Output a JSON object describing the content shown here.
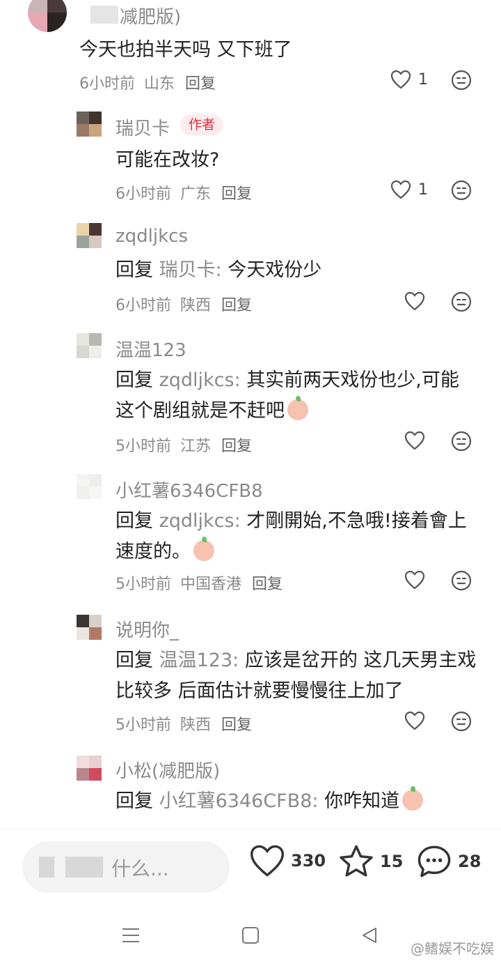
{
  "comments": [
    {
      "name": "减肥版)",
      "author_badge": "",
      "content": "今天也拍半天吗 又下班了",
      "time": "6小时前",
      "location": "山东",
      "reply_label": "回复",
      "likes": "1"
    },
    {
      "name": "瑞贝卡",
      "author_badge": "作者",
      "content": "可能在改妆?",
      "time": "6小时前",
      "location": "广东",
      "reply_label": "回复",
      "likes": "1"
    },
    {
      "name": "zqdljkcs",
      "reply_prefix": "回复",
      "reply_target": "瑞贝卡:",
      "content": "今天戏份少",
      "time": "6小时前",
      "location": "陕西",
      "reply_label": "回复",
      "likes": ""
    },
    {
      "name": "温温123",
      "reply_prefix": "回复",
      "reply_target": "zqdljkcs:",
      "content": "其实前两天戏份也少,可能这个剧组就是不赶吧",
      "time": "5小时前",
      "location": "江苏",
      "reply_label": "回复",
      "likes": ""
    },
    {
      "name": "小红薯6346CFB8",
      "reply_prefix": "回复",
      "reply_target": "zqdljkcs:",
      "content": "才剛開始,不急哦!接着會上速度的。",
      "time": "5小时前",
      "location": "中国香港",
      "reply_label": "回复",
      "likes": ""
    },
    {
      "name": "说明你_",
      "reply_prefix": "回复",
      "reply_target": "温温123:",
      "content": "应该是岔开的 这几天男主戏比较多 后面估计就要慢慢往上加了",
      "time": "5小时前",
      "location": "陕西",
      "reply_label": "回复",
      "likes": ""
    },
    {
      "name": "小松(减肥版)",
      "reply_prefix": "回复",
      "reply_target": "小红薯6346CFB8:",
      "content": "你咋知道",
      "time": "",
      "location": "",
      "reply_label": "",
      "likes": ""
    }
  ],
  "bottom_bar": {
    "input_placeholder": "什么...",
    "like_count": "330",
    "star_count": "15",
    "comment_count": "28"
  },
  "watermark": "@鳍娱不吃娱",
  "colors": {
    "accent_red": "#e0323c",
    "meta_gray": "#8a8a8a"
  }
}
